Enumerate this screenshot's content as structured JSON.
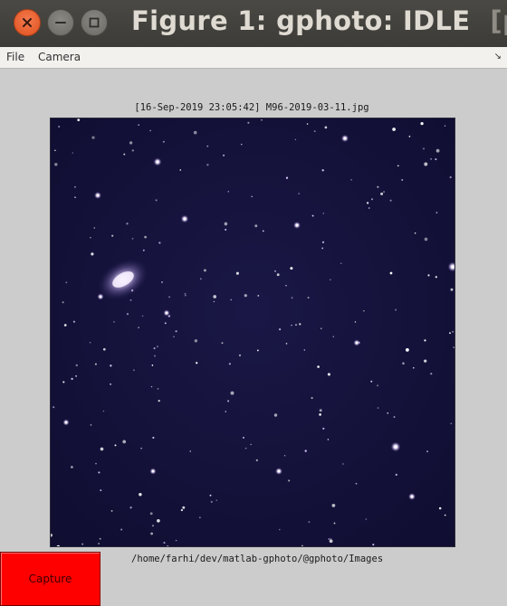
{
  "window": {
    "title": "Figure 1: gphoto: IDLE",
    "title_extra": "[po"
  },
  "menubar": {
    "file": "File",
    "camera": "Camera"
  },
  "image": {
    "title": "[16-Sep-2019 23:05:42] M96-2019-03-11.jpg",
    "folder": "/home/farhi/dev/matlab-gphoto/@gphoto/Images"
  },
  "buttons": {
    "capture": "Capture"
  },
  "colors": {
    "capture_bg": "#ff0000",
    "sky": "#121038",
    "close_button": "#e95420"
  },
  "icons": [
    "close-icon",
    "minimize-icon",
    "maximize-icon",
    "menu-arrow-icon"
  ]
}
